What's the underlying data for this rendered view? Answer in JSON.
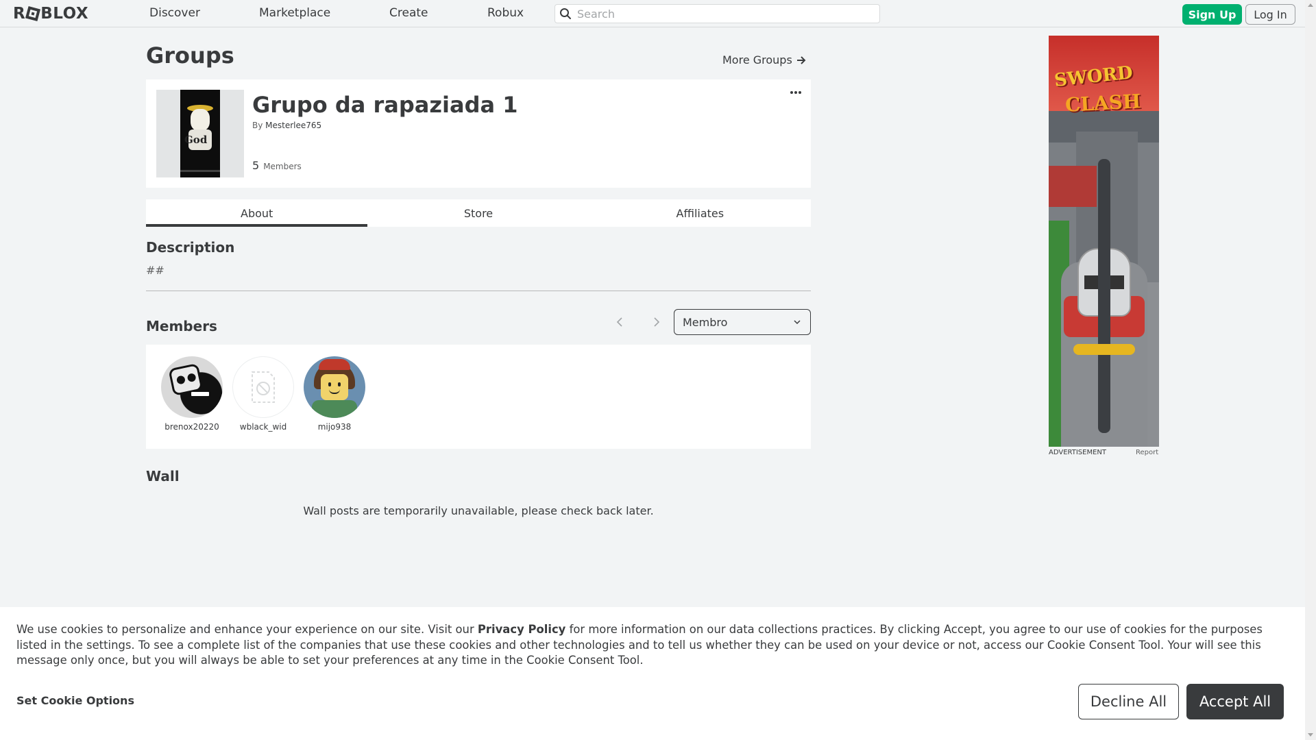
{
  "brand": {
    "logo": "ROBLOX"
  },
  "nav": {
    "links": [
      "Discover",
      "Marketplace",
      "Create",
      "Robux"
    ],
    "search_placeholder": "Search",
    "signup_label": "Sign Up",
    "login_label": "Log In"
  },
  "page": {
    "title": "Groups",
    "more_groups": "More Groups"
  },
  "group": {
    "name": "Grupo da rapaziada 1",
    "by_label": "By",
    "owner": "Mesterlee765",
    "member_count": "5",
    "members_label": "Members",
    "thumb_text": "God"
  },
  "tabs": [
    "About",
    "Store",
    "Affiliates"
  ],
  "active_tab": "About",
  "description": {
    "title": "Description",
    "text": "##"
  },
  "members": {
    "title": "Members",
    "role_selected": "Membro",
    "list": [
      {
        "name": "brenox20220",
        "avatar": "avatar-skull"
      },
      {
        "name": "wblack_wid",
        "avatar": "avatar-unavailable-icon"
      },
      {
        "name": "mijo938",
        "avatar": "avatar-classic"
      }
    ]
  },
  "wall": {
    "title": "Wall",
    "message": "Wall posts are temporarily unavailable, please check back later."
  },
  "ad": {
    "label": "ADVERTISEMENT",
    "report": "Report",
    "text_line1": "SWORD",
    "text_line2": "CLASH"
  },
  "cookie_banner": {
    "text_before": "We use cookies to personalize and enhance your experience on our site. Visit our ",
    "privacy_link": "Privacy Policy",
    "text_after": " for more information on our data collections practices. By clicking Accept, you agree to our use of cookies for the purposes listed in the settings. To see a complete list of the companies that use these cookies and other technologies and to tell us whether they can be used on your device or not, access our Cookie Consent Tool. Your will see this message only once, but you will always be able to set your preferences at any time in the Cookie Consent Tool.",
    "options_label": "Set Cookie Options",
    "decline_label": "Decline All",
    "accept_label": "Accept All"
  },
  "colors": {
    "signup": "#00b06f",
    "accept": "#393b3d",
    "background": "#f2f4f5"
  }
}
